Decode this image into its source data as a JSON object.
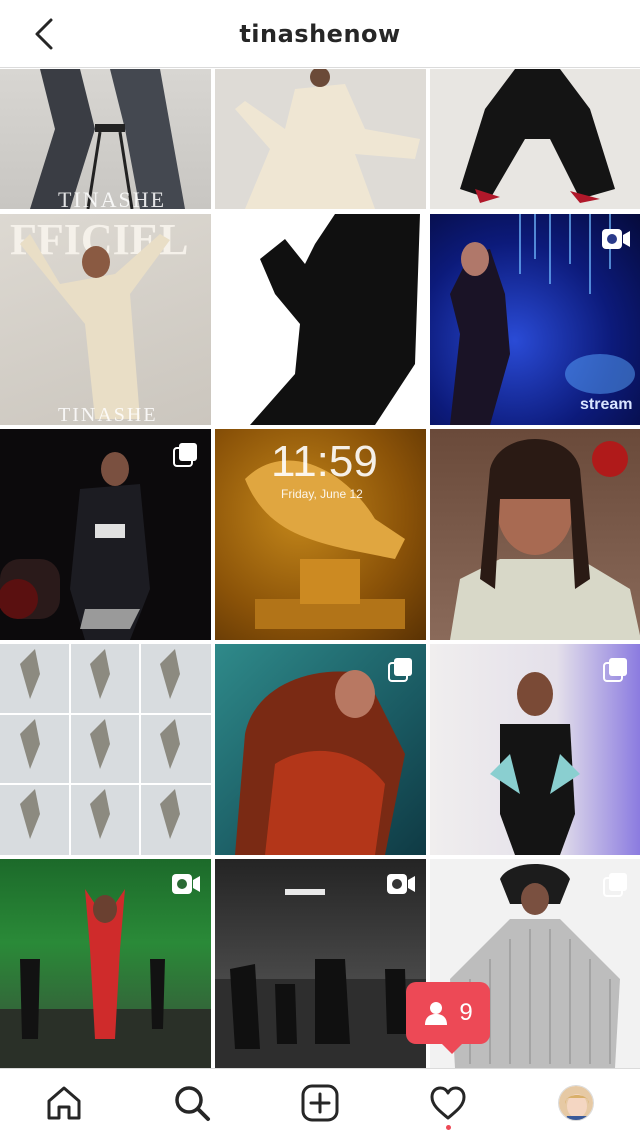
{
  "header": {
    "title": "tinashenow"
  },
  "posts": [
    {
      "row": 1,
      "col": 1,
      "badge": "none",
      "overlay_text": "TINASHE"
    },
    {
      "row": 1,
      "col": 2,
      "badge": "none",
      "overlay_text": ""
    },
    {
      "row": 1,
      "col": 3,
      "badge": "none",
      "overlay_text": ""
    },
    {
      "row": 2,
      "col": 1,
      "badge": "none",
      "overlay_text": "TINASHE"
    },
    {
      "row": 2,
      "col": 2,
      "badge": "none",
      "overlay_text": ""
    },
    {
      "row": 2,
      "col": 3,
      "badge": "video",
      "overlay_text": "stream"
    },
    {
      "row": 3,
      "col": 1,
      "badge": "carousel",
      "overlay_text": ""
    },
    {
      "row": 3,
      "col": 2,
      "badge": "none",
      "overlay_text": "11:59",
      "overlay_subtext": "Friday, June 12"
    },
    {
      "row": 3,
      "col": 3,
      "badge": "none",
      "overlay_text": ""
    },
    {
      "row": 4,
      "col": 1,
      "badge": "none",
      "overlay_text": ""
    },
    {
      "row": 4,
      "col": 2,
      "badge": "carousel",
      "overlay_text": ""
    },
    {
      "row": 4,
      "col": 3,
      "badge": "carousel",
      "overlay_text": ""
    },
    {
      "row": 5,
      "col": 1,
      "badge": "video",
      "overlay_text": ""
    },
    {
      "row": 5,
      "col": 2,
      "badge": "video",
      "overlay_text": ""
    },
    {
      "row": 5,
      "col": 3,
      "badge": "carousel",
      "overlay_text": ""
    }
  ],
  "activity_toast": {
    "count": "9",
    "icon": "person-icon",
    "color": "#ed4956"
  },
  "tabbar": {
    "items": [
      {
        "name": "home",
        "icon": "home-icon"
      },
      {
        "name": "search",
        "icon": "search-icon",
        "active": true
      },
      {
        "name": "new-post",
        "icon": "plus-square-icon"
      },
      {
        "name": "activity",
        "icon": "heart-icon",
        "has_notification": true
      },
      {
        "name": "profile",
        "icon": "avatar"
      }
    ]
  },
  "colors": {
    "accent": "#ed4956",
    "text": "#262626",
    "border": "#dbdbdb"
  }
}
